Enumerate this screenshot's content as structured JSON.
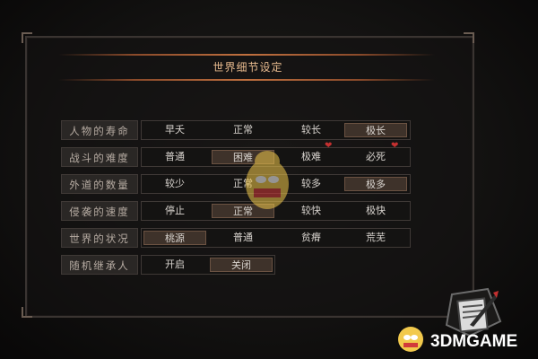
{
  "panel": {
    "title": "世界细节设定"
  },
  "settings": [
    {
      "label": "人物的寿命",
      "options": [
        "早夭",
        "正常",
        "较长",
        "极长"
      ],
      "selected": 3
    },
    {
      "label": "战斗的难度",
      "options": [
        "普通",
        "困难",
        "极难",
        "必死"
      ],
      "selected": 1
    },
    {
      "label": "外道的数量",
      "options": [
        "较少",
        "正常",
        "较多",
        "极多"
      ],
      "selected": 3
    },
    {
      "label": "侵袭的速度",
      "options": [
        "停止",
        "正常",
        "较快",
        "极快"
      ],
      "selected": 1
    },
    {
      "label": "世界的状况",
      "options": [
        "桃源",
        "普通",
        "贫瘠",
        "荒芜"
      ],
      "selected": 0
    },
    {
      "label": "随机继承人",
      "options": [
        "开启",
        "关闭"
      ],
      "selected": 1
    }
  ],
  "watermark": {
    "text": "3DMGAME"
  },
  "colors": {
    "title": "#e6b98d",
    "label_text": "#b7aca3",
    "option_text": "#d9d4cf",
    "selected_bg": "#3e322a",
    "heart": "#c43030",
    "accent_line": "#c0703f"
  },
  "icons": [
    "heart-icon",
    "scroll-quill-icon",
    "mascot-icon"
  ]
}
